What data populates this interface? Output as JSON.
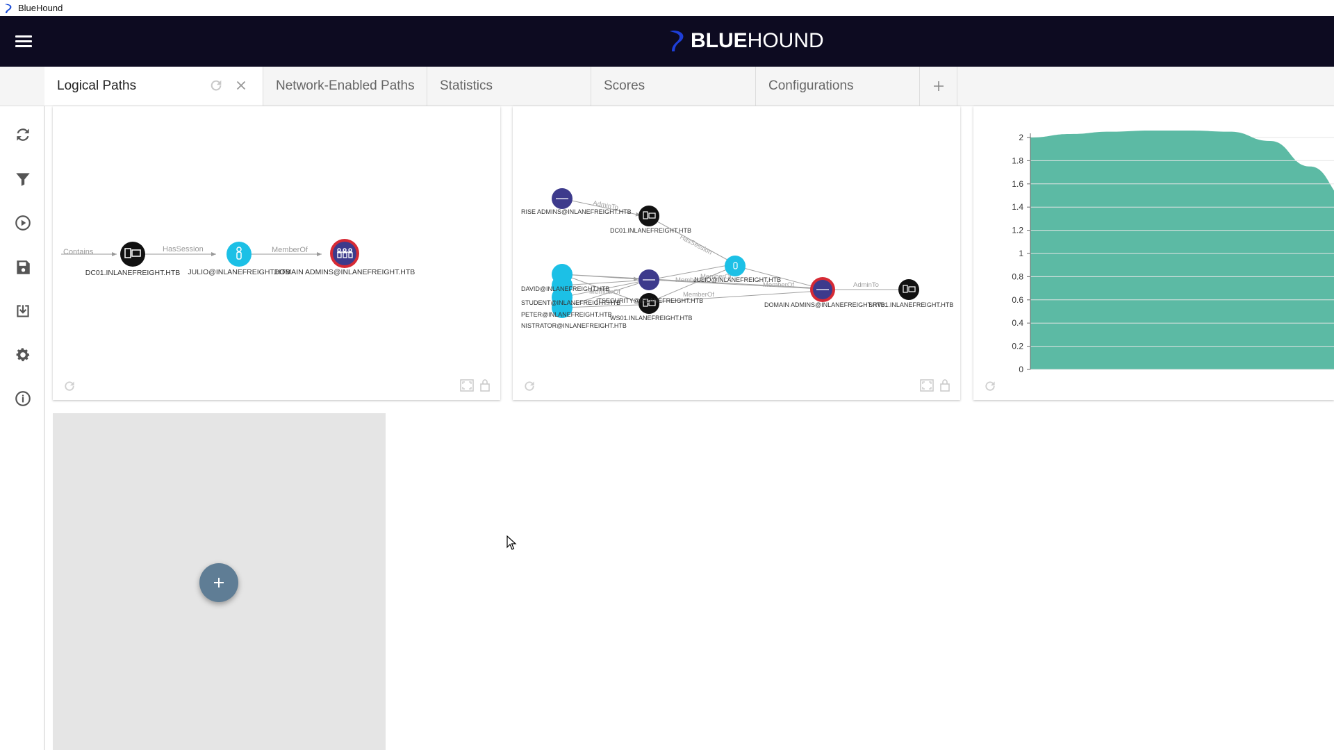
{
  "window": {
    "title": "BlueHound"
  },
  "header": {
    "brand_bold": "BLUE",
    "brand_light": "HOUND"
  },
  "tabs": [
    {
      "label": "Logical Paths",
      "active": true
    },
    {
      "label": "Network-Enabled Paths"
    },
    {
      "label": "Statistics"
    },
    {
      "label": "Scores"
    },
    {
      "label": "Configurations"
    }
  ],
  "colors": {
    "header_bg": "#0d0b21",
    "user_node": "#1cc0e6",
    "group_node": "#3d3a8c",
    "computer_node": "#111111",
    "highlight_ring": "#d62a35",
    "area_fill": "#5cbaa4",
    "fab": "#5f7d95"
  },
  "sidebar": {
    "icons": [
      "refresh-icon",
      "filter-icon",
      "play-icon",
      "save-icon",
      "download-icon",
      "gear-icon",
      "info-icon"
    ]
  },
  "graph1": {
    "edges": [
      "Contains",
      "HasSession",
      "MemberOf"
    ],
    "nodes": [
      "DC01.INLANEFREIGHT.HTB",
      "JULIO@INLANEFREIGHT.HTB",
      "DOMAIN ADMINS@INLANEFREIGHT.HTB"
    ]
  },
  "graph2": {
    "edges": [
      "AdminTo",
      "HasSession",
      "MemberOf",
      "MemberOf",
      "MemberOf",
      "MemberOf",
      "MemberOf",
      "AdminTo"
    ],
    "nodes": [
      "RISE ADMINS@INLANEFREIGHT.HTB",
      "DC01.INLANEFREIGHT.HTB",
      "JULIO@INLANEFREIGHT.HTB",
      "DAVID@INLANEFREIGHT.HTB",
      "STUDENT@INLANEFREIGHT.HTB",
      "PETER@INLANEFREIGHT.HTB",
      "NISTRATOR@INLANEFREIGHT.HTB",
      "ITSECURITY@INLANEFREIGHT.HTB",
      "WS01.INLANEFREIGHT.HTB",
      "DOMAIN ADMINS@INLANEFREIGHT.HTB",
      "SRV01.INLANEFREIGHT.HTB"
    ]
  },
  "chart_data": {
    "type": "area",
    "y_ticks": [
      "2",
      "1.8",
      "1.6",
      "1.4",
      "1.2",
      "1",
      "0.8",
      "0.6",
      "0.4",
      "0.2",
      "0"
    ],
    "ylim": [
      0,
      2
    ],
    "x": [
      0,
      1,
      2,
      3,
      4,
      5,
      6,
      7,
      8
    ],
    "y": [
      2.0,
      2.03,
      2.05,
      2.06,
      2.06,
      2.05,
      1.97,
      1.75,
      1.45
    ],
    "grid": true,
    "series": [
      {
        "values": [
          2.0,
          2.03,
          2.05,
          2.06,
          2.06,
          2.05,
          1.97,
          1.75,
          1.45
        ]
      }
    ]
  }
}
